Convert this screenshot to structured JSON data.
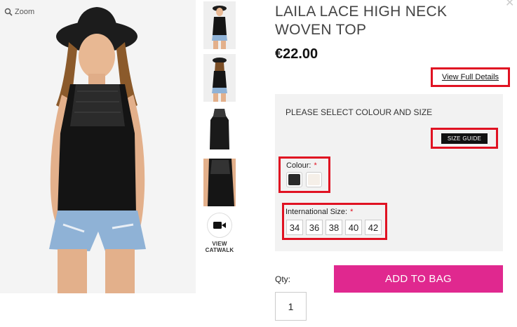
{
  "gallery": {
    "zoom_label": "Zoom",
    "catwalk_label_line1": "VIEW",
    "catwalk_label_line2": "CATWALK"
  },
  "product": {
    "title": "LAILA LACE HIGH NECK WOVEN TOP",
    "price": "€22.00",
    "full_details_label": "View Full Details"
  },
  "options": {
    "prompt": "PLEASE SELECT COLOUR AND SIZE",
    "size_guide_label": "SIZE GUIDE",
    "colour_label": "Colour:",
    "required_mark": "*",
    "colours": [
      {
        "name": "black",
        "hex": "#2a2a2a"
      },
      {
        "name": "cream",
        "hex": "#f5efe8"
      }
    ],
    "size_label": "International Size:",
    "sizes": [
      "34",
      "36",
      "38",
      "40",
      "42"
    ]
  },
  "purchase": {
    "qty_label": "Qty:",
    "qty_value": "1",
    "add_to_bag_label": "ADD TO BAG"
  },
  "colors": {
    "accent_pink": "#e0288f",
    "highlight_red": "#e01222"
  }
}
